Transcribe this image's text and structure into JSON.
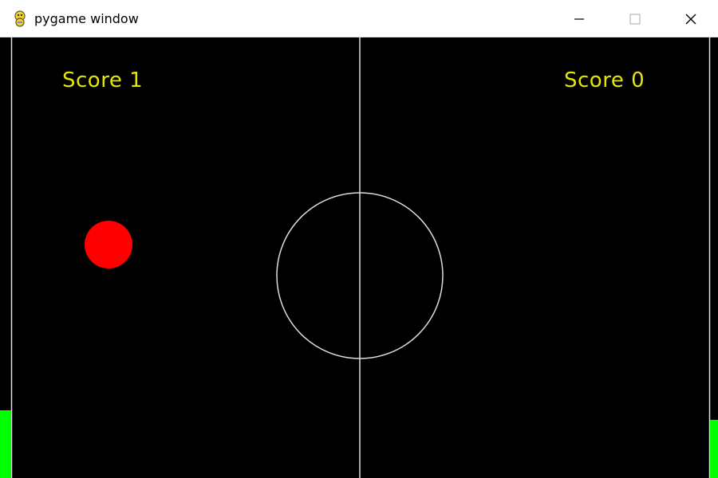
{
  "window": {
    "title": "pygame window",
    "icon": "pygame-snake-icon"
  },
  "controls": {
    "minimize_icon": "minimize-icon",
    "maximize_icon": "maximize-icon",
    "close_icon": "close-icon"
  },
  "game": {
    "background_color": "#000000",
    "line_color": "#dddddd",
    "score_color": "#e6e600",
    "ball_color": "#ff0000",
    "paddle_color": "#00ff00",
    "left_score": "Score 1",
    "right_score": "Score 0"
  }
}
